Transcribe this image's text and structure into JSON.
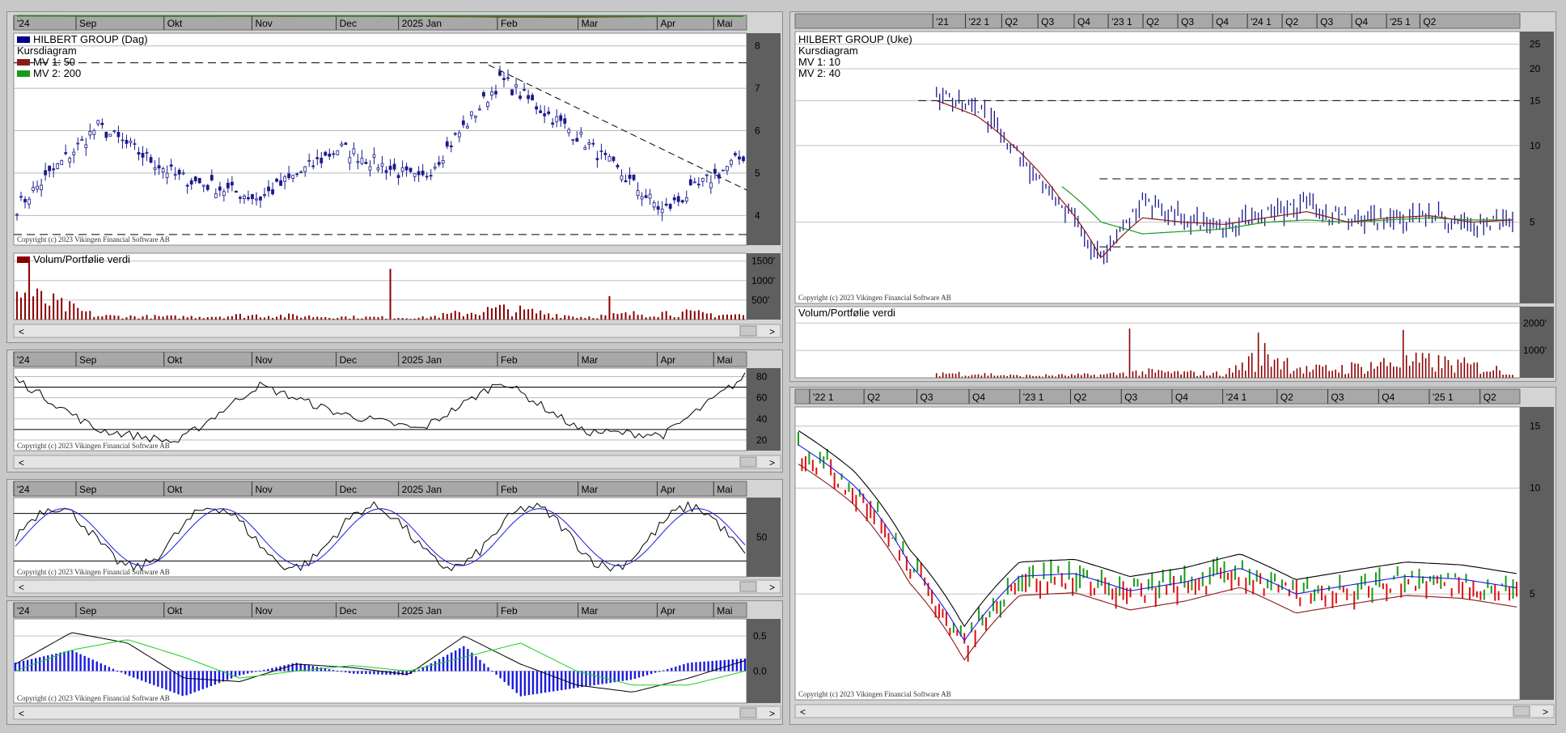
{
  "copyright": "Copyright (c) 2023 Vikingen Financial Software AB",
  "daily": {
    "months": [
      "'24",
      "Sep",
      "Okt",
      "Nov",
      "Dec",
      "2025 Jan",
      "Feb",
      "Mar",
      "Apr",
      "Mai"
    ],
    "title": "HILBERT GROUP (Dag)",
    "subtitle": "Kursdiagram",
    "mv1": "MV 1: 50",
    "mv2": "MV 2: 200",
    "price_ticks": [
      "8",
      "7",
      "6",
      "5",
      "4"
    ],
    "volume_title": "Volum/Portfølie verdi",
    "volume_ticks": [
      "1500'",
      "1000'",
      "500'"
    ],
    "rsi_ticks": [
      "80",
      "60",
      "40",
      "20"
    ],
    "stoch_ticks": [
      "50"
    ],
    "macd_ticks": [
      "0.5",
      "0.0"
    ]
  },
  "weekly": {
    "periods": [
      "'21",
      "'22 1",
      "Q2",
      "Q3",
      "Q4",
      "'23 1",
      "Q2",
      "Q3",
      "Q4",
      "'24 1",
      "Q2",
      "Q3",
      "Q4",
      "'25 1",
      "Q2"
    ],
    "title": "HILBERT GROUP (Uke)",
    "subtitle": "Kursdiagram",
    "mv1": "MV 1: 10",
    "mv2": "MV 2: 40",
    "price_ticks": [
      "25",
      "20",
      "15",
      "10",
      "5"
    ],
    "volume_title": "Volum/Portfølie verdi",
    "volume_ticks": [
      "2000'",
      "1000'"
    ]
  },
  "bands": {
    "periods": [
      "'22 1",
      "Q2",
      "Q3",
      "Q4",
      "'23 1",
      "Q2",
      "Q3",
      "Q4",
      "'24 1",
      "Q2",
      "Q3",
      "Q4",
      "'25 1",
      "Q2"
    ],
    "price_ticks": [
      "15",
      "10",
      "5"
    ]
  },
  "colors": {
    "candle": "#1a1a8c",
    "mv1": "#8b1a1a",
    "mv2": "#1a9a1a",
    "volume": "#8b0000",
    "up": "#1a9a1a",
    "down": "#e01010",
    "axis_bg": "#5f5f5f"
  },
  "chart_data": [
    {
      "type": "line",
      "name": "HILBERT GROUP (Dag)",
      "x": [
        "'24",
        "Sep",
        "Okt",
        "Nov",
        "Dec",
        "2025 Jan",
        "Feb",
        "Mar",
        "Apr",
        "Mai"
      ],
      "series": [
        {
          "name": "HILBERT GROUP (Dag)",
          "values": [
            4.2,
            6.1,
            4.9,
            4.4,
            5.6,
            4.8,
            7.2,
            5.8,
            4.1,
            5.4
          ]
        },
        {
          "name": "MV 1: 50",
          "values": [
            4.6,
            5.2,
            5.1,
            5.0,
            5.2,
            5.3,
            6.0,
            6.1,
            5.4,
            5.2
          ]
        },
        {
          "name": "MV 2: 200",
          "values": [
            4.8,
            4.9,
            4.9,
            4.8,
            4.9,
            5.0,
            5.1,
            5.1,
            5.1,
            5.1
          ]
        }
      ],
      "ylim": [
        3.3,
        8.3
      ],
      "ylabel": "",
      "xlabel": ""
    },
    {
      "type": "bar",
      "name": "Volum/Portfølie verdi",
      "categories": [
        "'24",
        "Sep",
        "Okt",
        "Nov",
        "Dec",
        "2025 Jan",
        "Feb",
        "Mar",
        "Apr",
        "Mai"
      ],
      "values": [
        1500,
        200,
        150,
        250,
        150,
        100,
        600,
        150,
        400,
        250
      ],
      "ylim": [
        0,
        1700
      ]
    },
    {
      "type": "line",
      "name": "RSI",
      "categories": [
        "'24",
        "Sep",
        "Okt",
        "Nov",
        "Dec",
        "2025 Jan",
        "Feb",
        "Mar",
        "Apr",
        "Mai"
      ],
      "values": [
        78,
        30,
        18,
        72,
        45,
        30,
        76,
        28,
        25,
        80
      ],
      "ylim": [
        10,
        88
      ]
    },
    {
      "type": "line",
      "name": "HILBERT GROUP (Uke)",
      "x": [
        "'21",
        "'22 1",
        "Q2",
        "Q3",
        "Q4",
        "'23 1",
        "Q2",
        "Q3",
        "Q4",
        "'24 1",
        "Q2",
        "Q3",
        "Q4",
        "'25 1",
        "Q2"
      ],
      "series": [
        {
          "name": "HILBERT GROUP (Uke)",
          "values": [
            16,
            14,
            9,
            6,
            3.5,
            6,
            5.2,
            4.8,
            5.4,
            5.8,
            5.0,
            5.2,
            5.4,
            4.9,
            5.3
          ]
        },
        {
          "name": "MV 1: 10",
          "values": [
            15,
            13,
            9.5,
            6.2,
            3.6,
            5.2,
            5.0,
            4.9,
            5.2,
            5.5,
            5.0,
            5.2,
            5.3,
            5.0,
            5.1
          ]
        },
        {
          "name": "MV 2: 40",
          "values": [
            null,
            null,
            null,
            7,
            5,
            4.5,
            4.6,
            4.7,
            5.0,
            5.1,
            5.0,
            5.1,
            5.2,
            5.1,
            5.1
          ]
        }
      ],
      "ylim": [
        2.4,
        28
      ],
      "ylabel": "",
      "xlabel": ""
    },
    {
      "type": "bar",
      "name": "Volum/Portfølie verdi",
      "categories": [
        "'21",
        "'22 1",
        "Q2",
        "Q3",
        "Q4",
        "'23 1",
        "Q2",
        "Q3",
        "Q4",
        "'24 1",
        "Q2",
        "Q3",
        "Q4",
        "'25 1",
        "Q2"
      ],
      "values": [
        500,
        400,
        200,
        250,
        300,
        600,
        500,
        400,
        2500,
        800,
        1000,
        1500,
        1600,
        1200,
        600
      ],
      "ylim": [
        0,
        2600
      ]
    },
    {
      "type": "line",
      "name": "Bands",
      "x": [
        "'22 1",
        "Q2",
        "Q3",
        "Q4",
        "'23 1",
        "Q2",
        "Q3",
        "Q4",
        "'24 1",
        "Q2",
        "Q3",
        "Q4",
        "'25 1",
        "Q2"
      ],
      "values": [
        13,
        10,
        6,
        3.6,
        5.5,
        5.6,
        5.0,
        5.3,
        5.8,
        4.9,
        5.2,
        5.5,
        5.4,
        5.1
      ],
      "ylim": [
        2.5,
        17
      ]
    }
  ]
}
